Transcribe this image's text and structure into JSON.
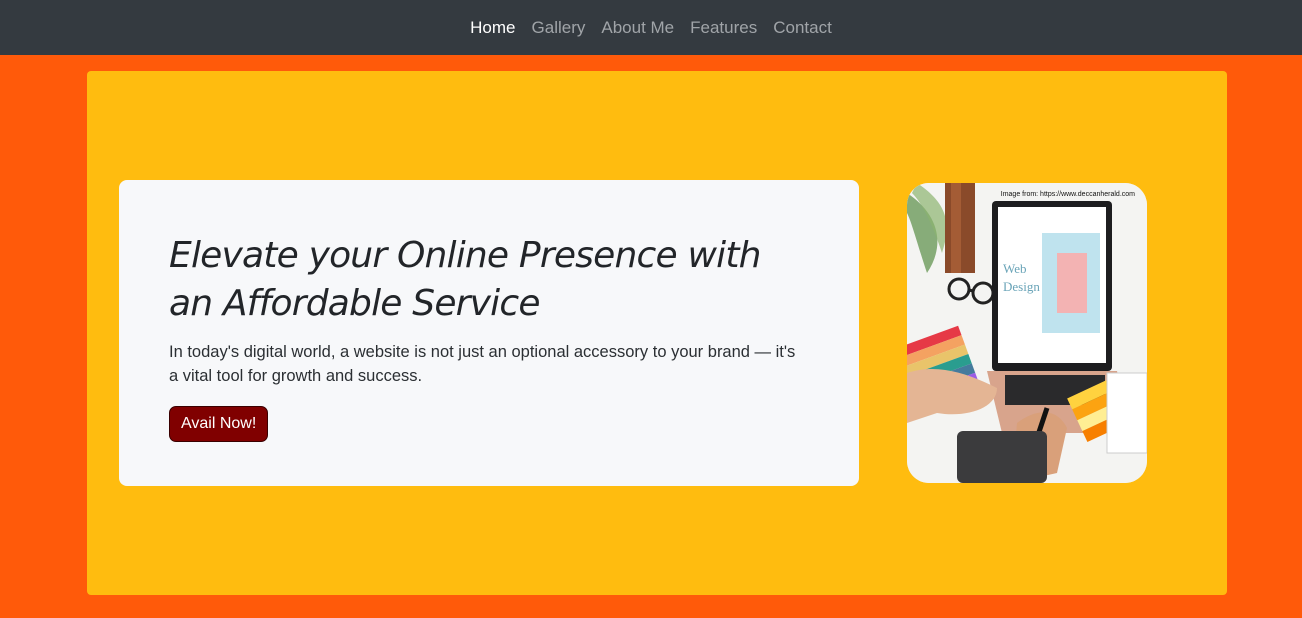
{
  "nav": {
    "items": [
      {
        "label": "Home",
        "active": true
      },
      {
        "label": "Gallery",
        "active": false
      },
      {
        "label": "About Me",
        "active": false
      },
      {
        "label": "Features",
        "active": false
      },
      {
        "label": "Contact",
        "active": false
      }
    ]
  },
  "hero": {
    "title": "Elevate your Online Presence with an Affordable Service",
    "description": "In today's digital world, a website is not just an optional accessory to your brand — it's a vital tool for growth and success.",
    "cta_label": "Avail Now!",
    "image_credit": "Image from: https://www.deccanherald.com",
    "image_screen_text": "Web Design"
  },
  "colors": {
    "page_bg": "#ff5a0a",
    "navbar_bg": "#343a40",
    "panel_bg": "#ffbc0f",
    "card_bg": "#f7f8fa",
    "cta_bg": "#800000"
  }
}
